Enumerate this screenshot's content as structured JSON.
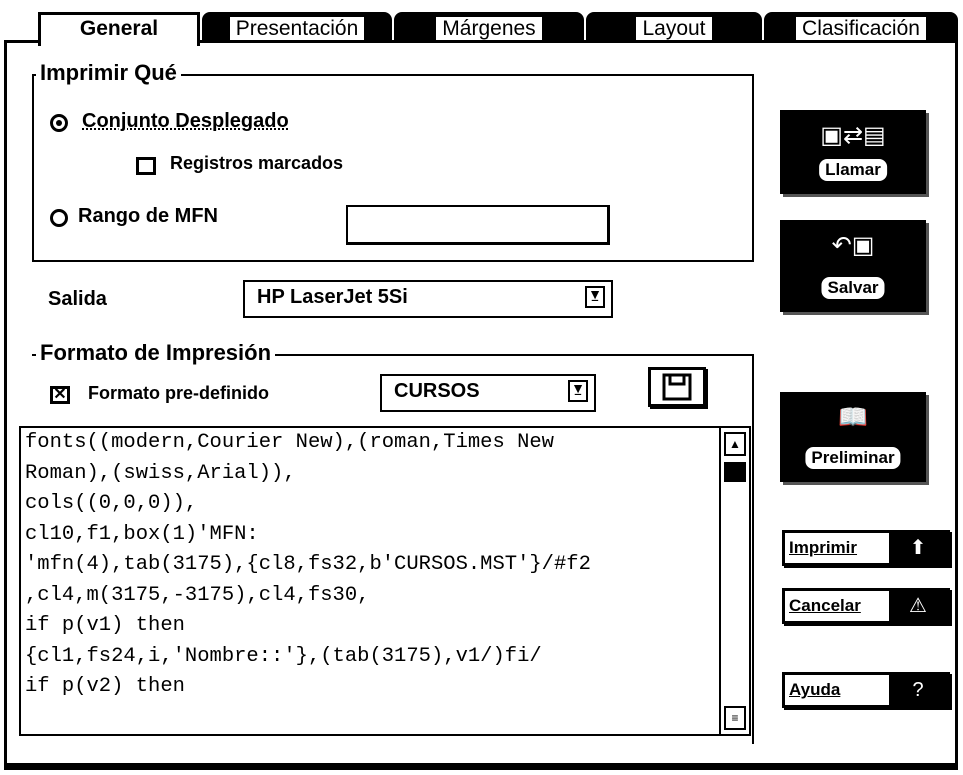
{
  "tabs": [
    "General",
    "Presentación",
    "Márgenes",
    "Layout",
    "Clasificación"
  ],
  "imprimir_que": {
    "title": "Imprimir Qué",
    "conjunto": "Conjunto Desplegado",
    "registros": "Registros marcados",
    "rango": "Rango de MFN",
    "rango_value": ""
  },
  "salida": {
    "label": "Salida",
    "value": "HP LaserJet 5Si"
  },
  "formato": {
    "title": "Formato de Impresión",
    "predef_label": "Formato pre-definido",
    "predef_value": "CURSOS"
  },
  "code": "fonts((modern,Courier New),(roman,Times New\nRoman),(swiss,Arial)),\ncols((0,0,0)),\ncl10,f1,box(1)'MFN:\n'mfn(4),tab(3175),{cl8,fs32,b'CURSOS.MST'}/#f2\n,cl4,m(3175,-3175),cl4,fs30,\nif p(v1) then\n{cl1,fs24,i,'Nombre::'},(tab(3175),v1/)fi/\nif p(v2) then",
  "buttons": {
    "llamar": "Llamar",
    "salvar": "Salvar",
    "preliminar": "Preliminar",
    "imprimir": "Imprimir",
    "cancelar": "Cancelar",
    "ayuda": "Ayuda"
  },
  "icons": {
    "llamar": "floppy-to-list-icon",
    "salvar": "floppy-arrow-icon",
    "preliminar": "open-book-icon",
    "imprimir": "printer-arrow-icon",
    "cancelar": "warning-triangle-icon",
    "ayuda": "help-question-icon"
  }
}
